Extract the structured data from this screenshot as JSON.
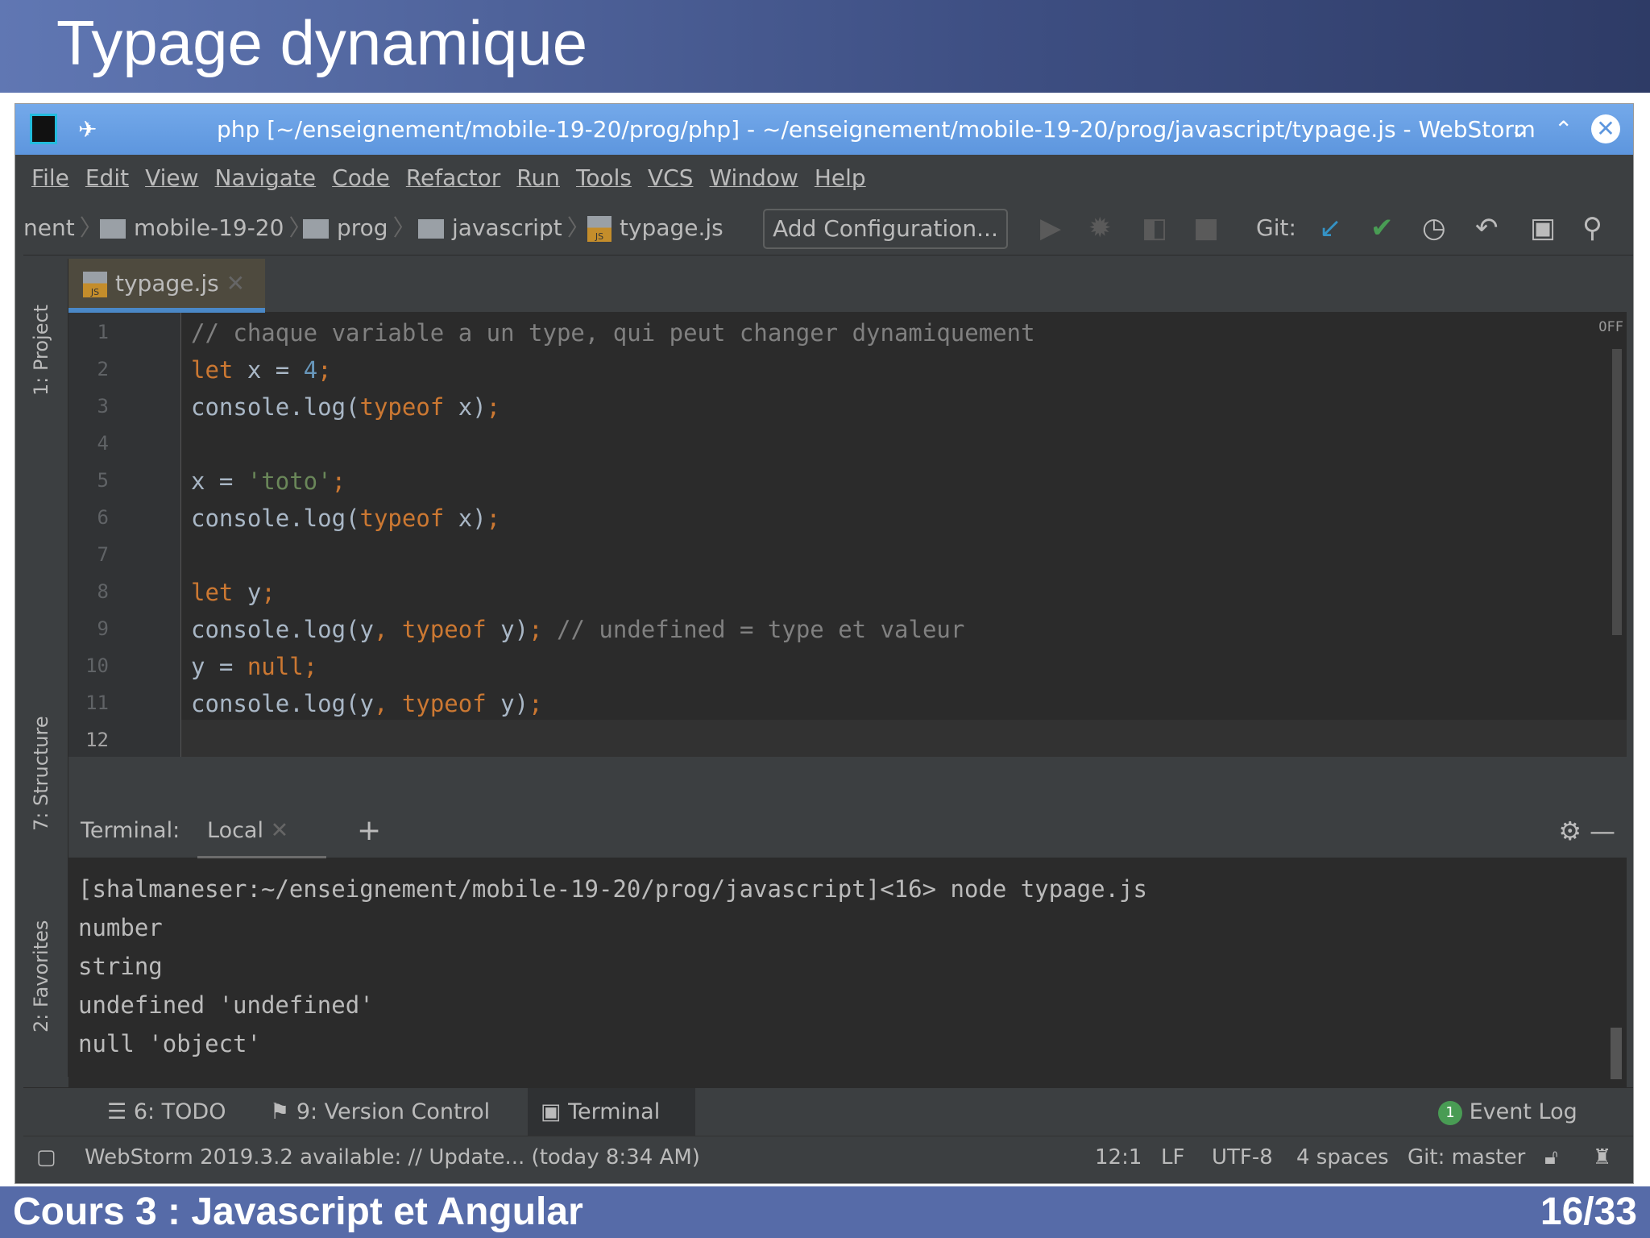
{
  "slide": {
    "title": "Typage dynamique",
    "footer": "Cours 3 : Javascript et Angular",
    "page": "16/33"
  },
  "window": {
    "title": "php [~/enseignement/mobile-19-20/prog/php] - ~/enseignement/mobile-19-20/prog/javascript/typage.js - WebStorm"
  },
  "menu": [
    "File",
    "Edit",
    "View",
    "Navigate",
    "Code",
    "Refactor",
    "Run",
    "Tools",
    "VCS",
    "Window",
    "Help"
  ],
  "breadcrumb": [
    "nent",
    "mobile-19-20",
    "prog",
    "javascript",
    "typage.js"
  ],
  "toolbar": {
    "add_config": "Add Configuration...",
    "git_label": "Git:"
  },
  "side": {
    "project": "1: Project",
    "structure": "7: Structure",
    "favorites": "2: Favorites"
  },
  "editor": {
    "tab": "typage.js",
    "off": "OFF",
    "line_numbers": [
      "1",
      "2",
      "3",
      "4",
      "5",
      "6",
      "7",
      "8",
      "9",
      "10",
      "11",
      "12"
    ]
  },
  "terminal": {
    "label": "Terminal:",
    "tab": "Local",
    "lines": [
      "[shalmaneser:~/enseignement/mobile-19-20/prog/javascript]<16> node typage.js",
      "number",
      "string",
      "undefined 'undefined'",
      "null 'object'"
    ]
  },
  "bottom_tabs": {
    "todo": "6: TODO",
    "vc": "9: Version Control",
    "terminal": "Terminal",
    "event_log": "Event Log",
    "event_count": "1"
  },
  "status": {
    "message": "WebStorm 2019.3.2 available: // Update... (today 8:34 AM)",
    "position": "12:1",
    "line_sep": "LF",
    "encoding": "UTF-8",
    "indent": "4 spaces",
    "git": "Git: master"
  }
}
